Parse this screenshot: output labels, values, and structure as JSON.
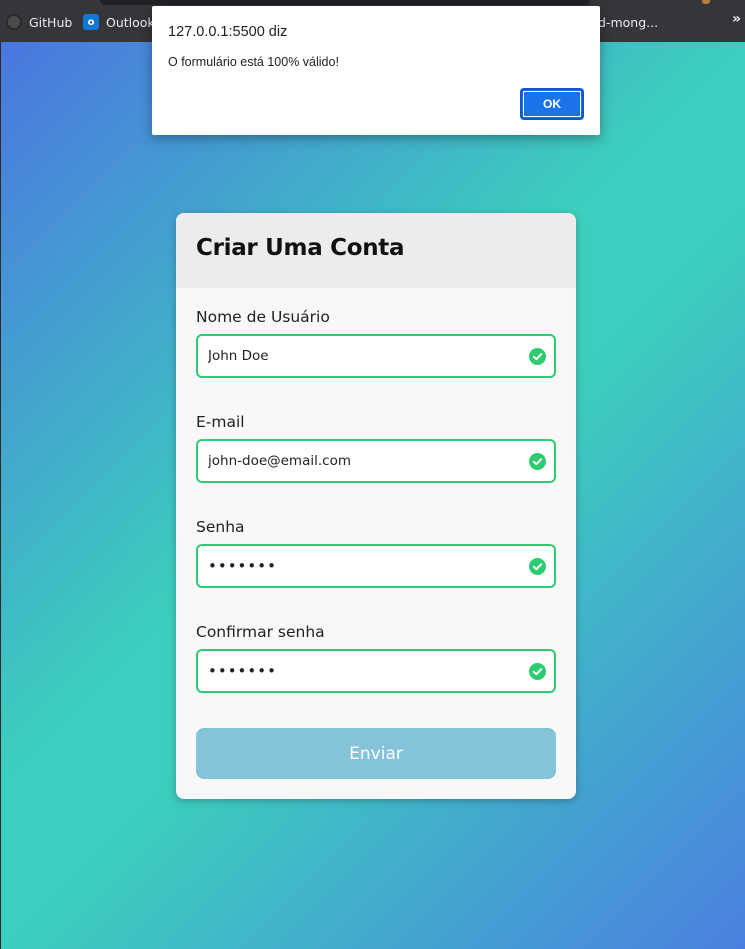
{
  "bookmarks": {
    "items": [
      {
        "label": "GitHub",
        "icon": "github-icon"
      },
      {
        "label": "Outlook",
        "icon": "outlook-icon"
      },
      {
        "label": "d-mong..."
      }
    ],
    "overflow": "»"
  },
  "alert": {
    "origin": "127.0.0.1:5500 diz",
    "message": "O formulário está 100% válido!",
    "ok_label": "OK"
  },
  "form": {
    "title": "Criar Uma Conta",
    "fields": [
      {
        "label": "Nome de Usuário",
        "value": "John Doe",
        "type": "text",
        "status": "valid"
      },
      {
        "label": "E-mail",
        "value": "john-doe@email.com",
        "type": "text",
        "status": "valid"
      },
      {
        "label": "Senha",
        "value": "1234567",
        "type": "password",
        "status": "valid"
      },
      {
        "label": "Confirmar senha",
        "value": "1234567",
        "type": "password",
        "status": "valid"
      }
    ],
    "submit_label": "Enviar"
  },
  "colors": {
    "valid_border": "#2ecc71",
    "submit_bg": "#85c3da",
    "gradient_blue": "#4a76e0",
    "gradient_teal": "#3ccfbd",
    "ok_button": "#1a73e8"
  }
}
